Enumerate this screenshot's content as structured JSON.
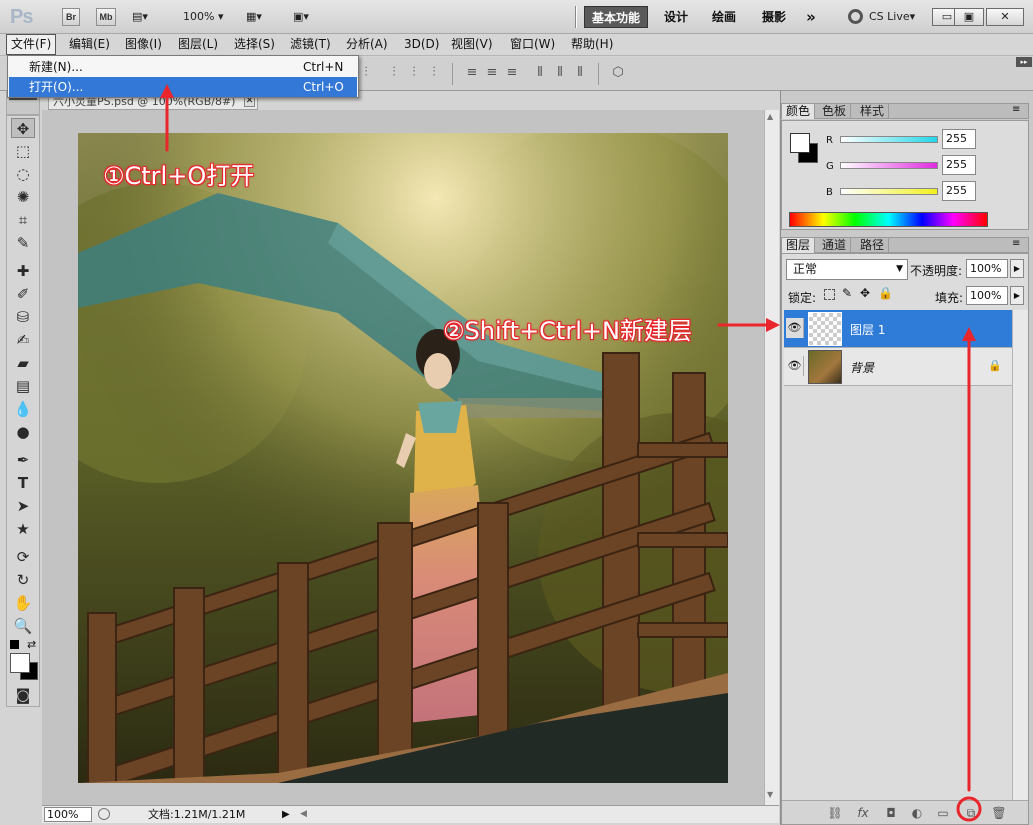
{
  "app": {
    "logo": "Ps",
    "bridge_label": "Br",
    "minibridge_label": "Mb",
    "zoom_dropdown": "100%",
    "workspaces": [
      "基本功能",
      "设计",
      "绘画",
      "摄影"
    ],
    "more": "»",
    "cslive": "CS Live",
    "window_buttons": [
      "▭",
      "▣",
      "✕"
    ]
  },
  "menubar": {
    "items": [
      "文件(F)",
      "编辑(E)",
      "图像(I)",
      "图层(L)",
      "选择(S)",
      "滤镜(T)",
      "分析(A)",
      "3D(D)",
      "视图(V)",
      "窗口(W)",
      "帮助(H)"
    ]
  },
  "file_menu": {
    "items": [
      {
        "label": "新建(N)...",
        "shortcut": "Ctrl+N"
      },
      {
        "label": "打开(O)...",
        "shortcut": "Ctrl+O"
      }
    ]
  },
  "document": {
    "tab_title": "六小灵童PS.psd @ 100%(RGB/8#)",
    "zoom": "100%",
    "doc_size": "文档:1.21M/1.21M"
  },
  "color_panel": {
    "tabs": [
      "颜色",
      "色板",
      "样式"
    ],
    "channels": [
      {
        "name": "R",
        "value": "255",
        "color": "#22d5e8"
      },
      {
        "name": "G",
        "value": "255",
        "color": "#e02ae0"
      },
      {
        "name": "B",
        "value": "255",
        "color": "#f0f020"
      }
    ]
  },
  "layers_panel": {
    "tabs": [
      "图层",
      "通道",
      "路径"
    ],
    "blend_mode": "正常",
    "opacity_label": "不透明度:",
    "opacity_value": "100%",
    "lock_label": "锁定:",
    "fill_label": "填充:",
    "fill_value": "100%",
    "layers": [
      {
        "name": "图层 1",
        "selected": true
      },
      {
        "name": "背景",
        "selected": false,
        "locked": true
      }
    ]
  },
  "annotations": {
    "step1": "①Ctrl+O打开",
    "step2": "②Shift+Ctrl+N新建层",
    "accent": "#e8262c"
  }
}
